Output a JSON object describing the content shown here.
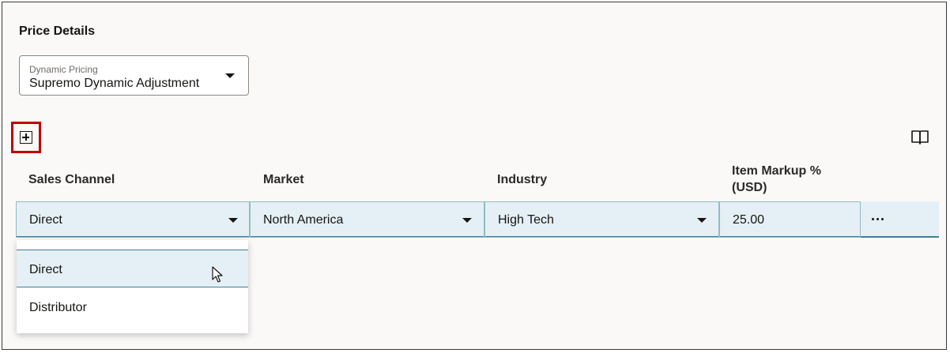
{
  "section": {
    "title": "Price Details"
  },
  "dynamic_pricing": {
    "label": "Dynamic Pricing",
    "value": "Supremo Dynamic Adjustment"
  },
  "table": {
    "headers": {
      "sales_channel": "Sales Channel",
      "market": "Market",
      "industry": "Industry",
      "markup_line1": "Item Markup %",
      "markup_line2": "(USD)"
    },
    "row": {
      "sales_channel": "Direct",
      "market": "North America",
      "industry": "High Tech",
      "markup": "25.00"
    }
  },
  "dropdown": {
    "options": [
      "Direct",
      "Distributor"
    ],
    "selected": "Direct"
  },
  "icons": {
    "add": "add-row-icon",
    "book": "book-icon",
    "more": "more-actions-icon",
    "caret": "chevron-down-icon"
  },
  "colors": {
    "accent_border": "#c00000",
    "row_bg": "#e4f0f5",
    "row_accent": "#3e7e94"
  }
}
